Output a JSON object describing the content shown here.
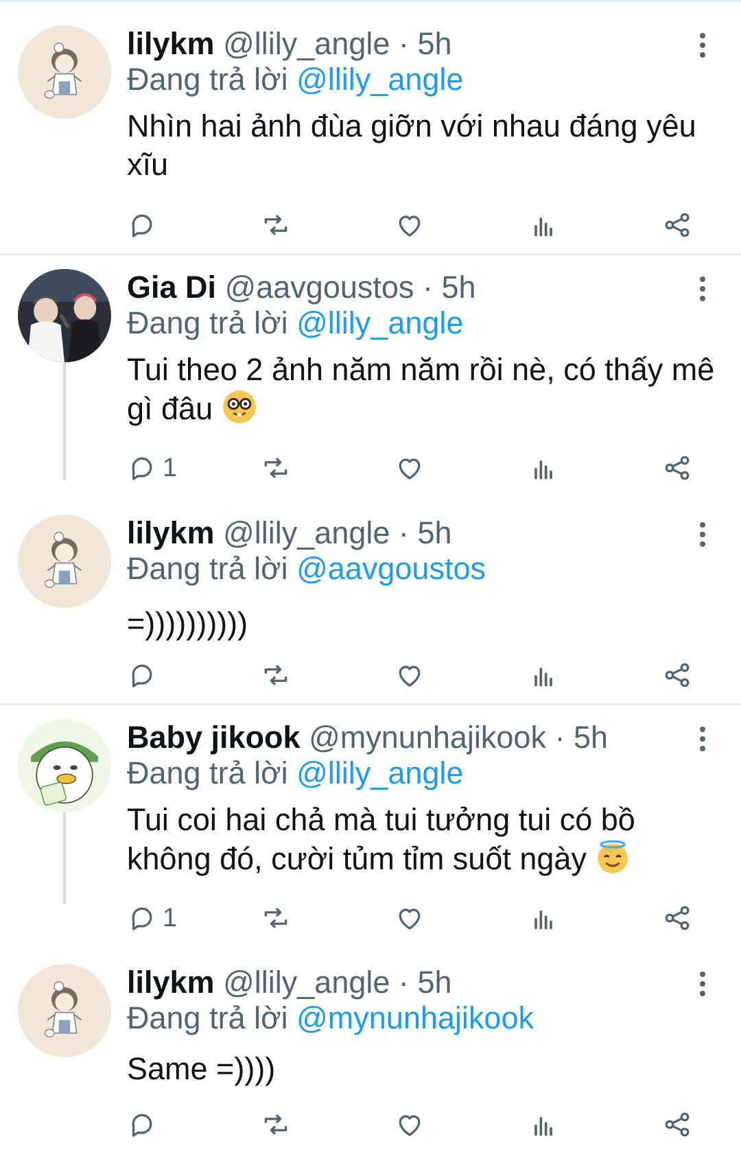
{
  "tweets": [
    {
      "name": "lilykm",
      "handle": "@llily_angle",
      "dot": "·",
      "time": "5h",
      "reply_prefix": "Đang trả lời",
      "reply_to": "@llily_angle",
      "text": "Nhìn hai ảnh đùa giỡn với nhau đáng yêu xĩu",
      "reply_count": "",
      "avatar": "girl-avatar"
    },
    {
      "name": "Gia Di",
      "handle": "@aavgoustos",
      "dot": "·",
      "time": "5h",
      "reply_prefix": "Đang trả lời",
      "reply_to": "@llily_angle",
      "text": "Tui theo 2 ảnh năm năm rồi nè, có thấy mê gì đâu",
      "emoji": "nerd-face-emoji",
      "reply_count": "1",
      "avatar": "photo-avatar"
    },
    {
      "name": "lilykm",
      "handle": "@llily_angle",
      "dot": "·",
      "time": "5h",
      "reply_prefix": "Đang trả lời",
      "reply_to": "@aavgoustos",
      "text": "=))))))))))",
      "reply_count": "",
      "avatar": "girl-avatar"
    },
    {
      "name": "Baby jikook",
      "handle": "@mynunhajikook",
      "dot": "·",
      "time": "5h",
      "reply_prefix": "Đang trả lời",
      "reply_to": "@llily_angle",
      "text": "Tui coi hai chả mà tui tưởng tui có bồ không đó, cười tủm tỉm suốt ngày",
      "emoji": "halo-smile-emoji",
      "reply_count": "1",
      "avatar": "duck-avatar"
    },
    {
      "name": "lilykm",
      "handle": "@llily_angle",
      "dot": "·",
      "time": "5h",
      "reply_prefix": "Đang trả lời",
      "reply_to": "@mynunhajikook",
      "text": "Same =))))",
      "reply_count": "",
      "avatar": "girl-avatar"
    }
  ],
  "icons": {
    "reply": "comment-icon",
    "retweet": "retweet-icon",
    "like": "heart-icon",
    "analytics": "analytics-icon",
    "share": "share-icon",
    "more": "more-vertical-icon"
  },
  "colors": {
    "mention": "#1d9bf0",
    "secondary_text": "#536471",
    "primary_text": "#0f1419",
    "divider": "#e6ecf0",
    "thread_line": "#cfd9de"
  }
}
